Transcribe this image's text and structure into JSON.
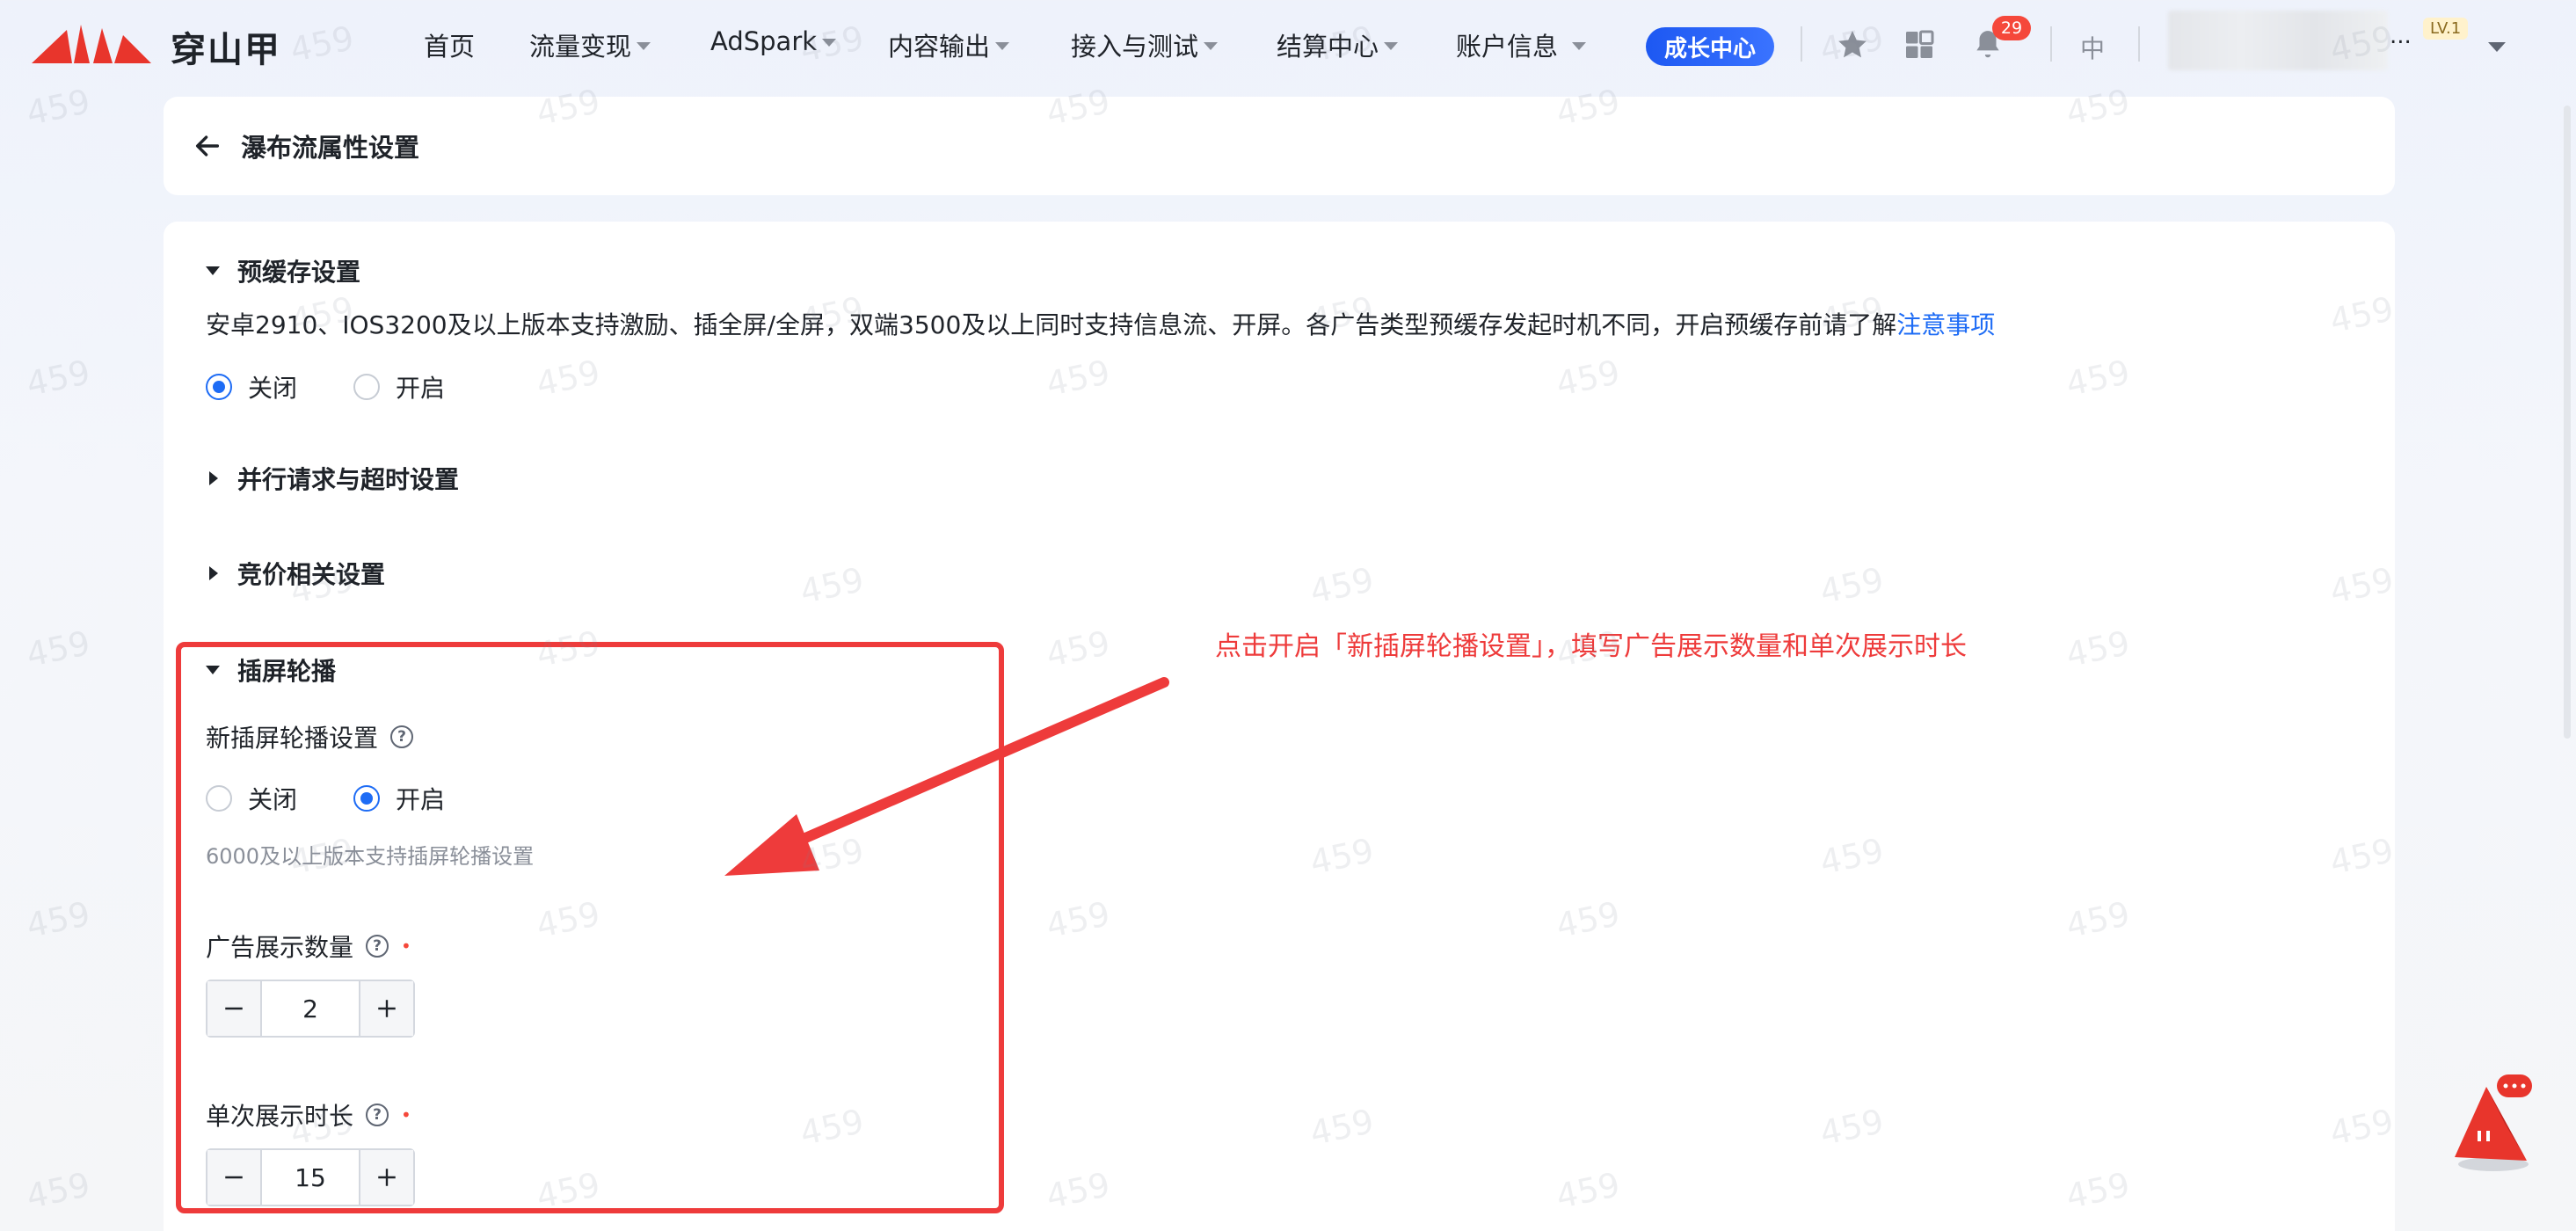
{
  "app": {
    "logo_text": "穿山甲",
    "brand_color": "#e8352c"
  },
  "nav": {
    "items": [
      {
        "label": "首页",
        "has_caret": false
      },
      {
        "label": "流量变现",
        "has_caret": true
      },
      {
        "label": "AdSpark",
        "has_caret": true
      },
      {
        "label": "内容输出",
        "has_caret": true
      },
      {
        "label": "接入与测试",
        "has_caret": true
      },
      {
        "label": "结算中心",
        "has_caret": true
      },
      {
        "label": "账户信息",
        "has_caret": true
      }
    ],
    "growth_label": "成长中心",
    "notification_count": "29",
    "lang_label": "中",
    "account_ellipsis": "...",
    "level_label": "LV.1",
    "icons": [
      "star-icon",
      "grid-icon",
      "bell-icon"
    ]
  },
  "header": {
    "title": "瀑布流属性设置"
  },
  "sections": {
    "precache": {
      "title": "预缓存设置",
      "description": "安卓2910、IOS3200及以上版本支持激励、插全屏/全屏，双端3500及以上同时支持信息流、开屏。各广告类型预缓存发起时机不同，开启预缓存前请了解",
      "link_text": "注意事项",
      "options": [
        "关闭",
        "开启"
      ],
      "selected": "关闭"
    },
    "parallel": {
      "title": "并行请求与超时设置",
      "expanded": false
    },
    "bidding": {
      "title": "竞价相关设置",
      "expanded": false
    },
    "carousel": {
      "title": "插屏轮播",
      "new_setting_label": "新插屏轮播设置",
      "options": [
        "关闭",
        "开启"
      ],
      "selected": "开启",
      "hint": "6000及以上版本支持插屏轮播设置",
      "ad_count_label": "广告展示数量",
      "ad_count_value": "2",
      "duration_label": "单次展示时长",
      "duration_value": "15",
      "required_mark": "•"
    }
  },
  "annotation": {
    "text": "点击开启「新插屏轮播设置」，填写广告展示数量和单次展示时长",
    "color": "#ee3b3b"
  },
  "watermark": {
    "text": "459"
  },
  "colors": {
    "primary": "#1e6cf5",
    "danger": "#f5483b",
    "growth_button": "#1d58f2"
  }
}
